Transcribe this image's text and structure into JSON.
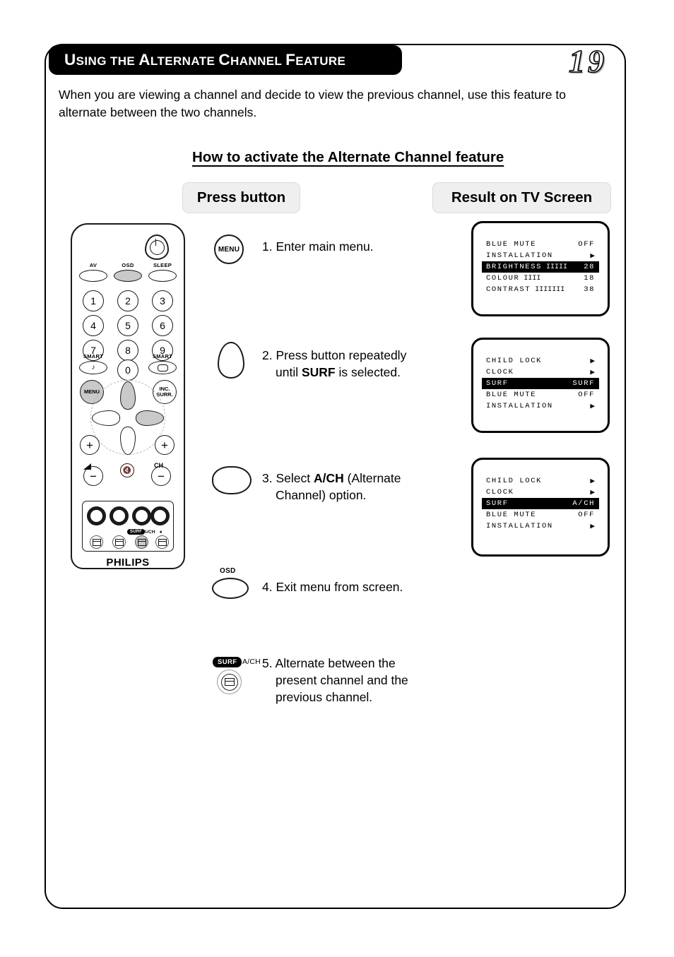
{
  "header": {
    "title_full": "USING THE ALTERNATE CHANNEL FEATURE",
    "title_parts": [
      "U",
      "SING THE ",
      "A",
      "LTERNATE ",
      "C",
      "HANNEL ",
      "F",
      "EATURE"
    ],
    "page_number": "19"
  },
  "intro": {
    "text": "When you are viewing a channel and decide to view the previous channel, use this feature to alternate between the two channels."
  },
  "section": {
    "heading": "How to activate the Alternate Channel feature"
  },
  "columns": {
    "press_button": "Press button",
    "result_on_tv": "Result on TV Screen"
  },
  "steps": [
    {
      "number": "1.",
      "text": "Enter main menu.",
      "icon": "menu-button-icon",
      "icon_label": "MENU"
    },
    {
      "number": "2.",
      "text_pre": "Press button repeatedly until ",
      "text_bold": "SURF",
      "text_post": " is selected.",
      "line1": "Press button repeatedly",
      "line2_pre": "until ",
      "line2_bold": "SURF",
      "line2_post": " is selected.",
      "icon": "cursor-down-button-icon"
    },
    {
      "number": "3.",
      "line1_pre": "Select ",
      "line1_bold": "A/CH",
      "line1_post": " (Alternate",
      "line2": "Channel) option.",
      "icon": "cursor-right-button-icon"
    },
    {
      "number": "4.",
      "text": "Exit menu from screen.",
      "icon": "osd-button-icon",
      "icon_label": "OSD"
    },
    {
      "number": "5.",
      "line1": "Alternate between the",
      "line2": "present channel and the",
      "line3": "previous channel.",
      "icon": "surf-ach-button-icon",
      "badge": "SURF",
      "badge_side_label": "A/CH"
    }
  ],
  "tv_screens": [
    {
      "name": "main-menu-screen",
      "rows": [
        {
          "label": "BLUE MUTE",
          "value": "OFF",
          "arrow": false,
          "bars": "",
          "highlighted": false
        },
        {
          "label": "INSTALLATION",
          "value": "",
          "arrow": true,
          "bars": "",
          "highlighted": false
        },
        {
          "label": "BRIGHTNESS",
          "value": "28",
          "arrow": false,
          "bars": "IIIII",
          "highlighted": true
        },
        {
          "label": "COLOUR",
          "value": "18",
          "arrow": false,
          "bars": "IIII",
          "highlighted": false
        },
        {
          "label": "CONTRAST",
          "value": "38",
          "arrow": false,
          "bars": "IIIIIII",
          "highlighted": false
        }
      ]
    },
    {
      "name": "surf-menu-screen",
      "rows": [
        {
          "label": "CHILD LOCK",
          "value": "",
          "arrow": true,
          "bars": "",
          "highlighted": false
        },
        {
          "label": "CLOCK",
          "value": "",
          "arrow": true,
          "bars": "",
          "highlighted": false
        },
        {
          "label": "SURF",
          "value": "SURF",
          "arrow": false,
          "bars": "",
          "highlighted": true
        },
        {
          "label": "BLUE MUTE",
          "value": "OFF",
          "arrow": false,
          "bars": "",
          "highlighted": false
        },
        {
          "label": "INSTALLATION",
          "value": "",
          "arrow": true,
          "bars": "",
          "highlighted": false
        }
      ]
    },
    {
      "name": "surf-ach-selected-screen",
      "rows": [
        {
          "label": "CHILD LOCK",
          "value": "",
          "arrow": true,
          "bars": "",
          "highlighted": false
        },
        {
          "label": "CLOCK",
          "value": "",
          "arrow": true,
          "bars": "",
          "highlighted": false
        },
        {
          "label": "SURF",
          "value": "A/CH",
          "arrow": false,
          "bars": "",
          "highlighted": true
        },
        {
          "label": "BLUE MUTE",
          "value": "OFF",
          "arrow": false,
          "bars": "",
          "highlighted": false
        },
        {
          "label": "INSTALLATION",
          "value": "",
          "arrow": true,
          "bars": "",
          "highlighted": false
        }
      ]
    }
  ],
  "remote": {
    "brand": "PHILIPS",
    "top_labels": {
      "av": "AV",
      "osd": "OSD",
      "sleep": "SLEEP"
    },
    "numbers": [
      "1",
      "2",
      "3",
      "4",
      "5",
      "6",
      "7",
      "8",
      "9",
      "0"
    ],
    "smart_left_label": "SMART",
    "smart_right_label": "SMART",
    "smart_left_glyph": "♪",
    "menu_label": "MENU",
    "inc_surr_line1": "INC.",
    "inc_surr_line2": "SURR.",
    "plus": "+",
    "minus": "−",
    "ch_label": "CH",
    "bottom_surf_badge": "SURF",
    "bottom_ach_label": "A/CH",
    "bottom_pause_label": "⏸"
  },
  "colors": {
    "accent_black": "#000000",
    "pill_gray": "#efefef",
    "button_shade": "#c9c9c9",
    "page_white": "#ffffff"
  }
}
